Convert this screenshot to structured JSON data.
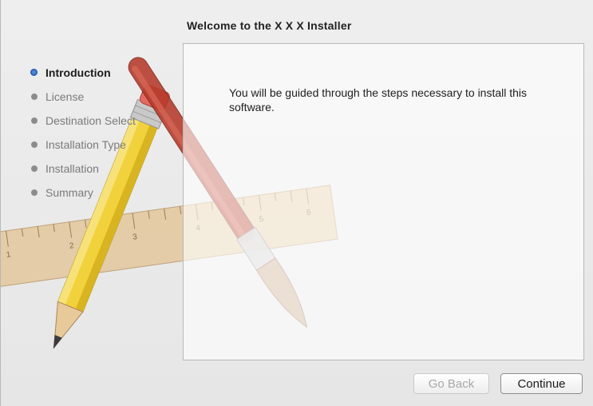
{
  "window": {
    "title": "Welcome to the X X X Installer"
  },
  "sidebar": {
    "steps": [
      {
        "label": "Introduction",
        "active": true
      },
      {
        "label": "License",
        "active": false
      },
      {
        "label": "Destination Select",
        "active": false
      },
      {
        "label": "Installation Type",
        "active": false
      },
      {
        "label": "Installation",
        "active": false
      },
      {
        "label": "Summary",
        "active": false
      }
    ]
  },
  "content": {
    "message": "You will be guided through the steps necessary to install this software."
  },
  "buttons": {
    "back_label": "Go Back",
    "continue_label": "Continue"
  },
  "artwork": {
    "icons": [
      "pencil-icon",
      "paintbrush-icon",
      "ruler-icon"
    ],
    "ruler_ticks": [
      "1",
      "2",
      "3",
      "4",
      "5",
      "6"
    ]
  },
  "colors": {
    "active_bullet": "#4f86d6",
    "inactive_text": "#7a7a7a",
    "pencil_yellow": "#f2d23c",
    "brush_red": "#b53a2a",
    "ruler_wood": "#e3c79c"
  }
}
